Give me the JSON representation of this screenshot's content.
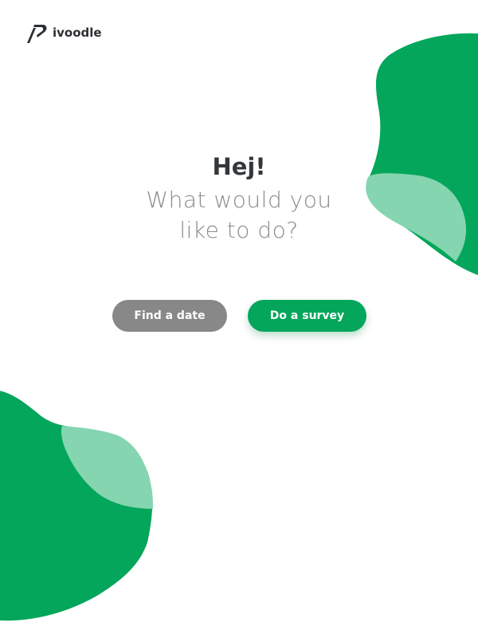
{
  "brand": {
    "name": "ivoodle",
    "logo_icon": "ivoodle-logo-icon"
  },
  "main": {
    "greeting": "Hej!",
    "question_line1": "What would you",
    "question_line2": "like to do?"
  },
  "actions": {
    "find_date_label": "Find a date",
    "survey_label": "Do a survey"
  },
  "colors": {
    "primary_green": "#03a65a",
    "light_green": "#84d5b0",
    "secondary_button": "#888888",
    "heading_text": "#33373c",
    "subheading_text": "#8a8c8f"
  }
}
